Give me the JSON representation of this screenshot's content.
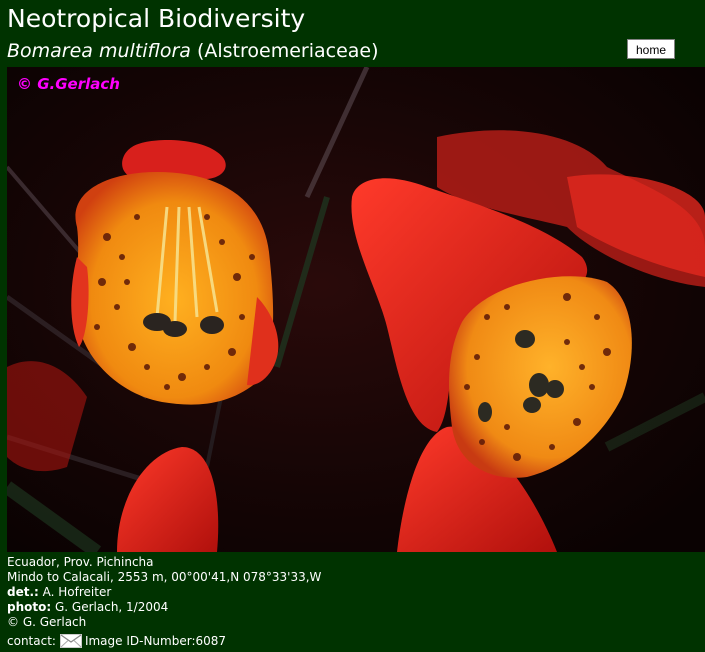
{
  "header": {
    "site_title": "Neotropical Biodiversity",
    "species": "Bomarea multiflora",
    "family": "(Alstroemeriaceae)",
    "home_label": "home"
  },
  "photo": {
    "watermark": "© G.Gerlach",
    "icon": "flower-photo"
  },
  "info": {
    "location_line1": "Ecuador, Prov. Pichincha",
    "location_line2": "Mindo to Calacali, 2553 m, 00°00'41,N 078°33'33,W",
    "det_label": "det.:",
    "det_value": "A. Hofreiter",
    "photo_label": "photo:",
    "photo_value": "G. Gerlach, 1/2004",
    "copyright": "© G. Gerlach",
    "contact_label": "contact:",
    "contact_icon": "mail-icon",
    "image_id": "Image ID-Number:6087"
  },
  "colors": {
    "background": "#003300",
    "text": "#ffffff",
    "watermark": "#ff00ff"
  }
}
